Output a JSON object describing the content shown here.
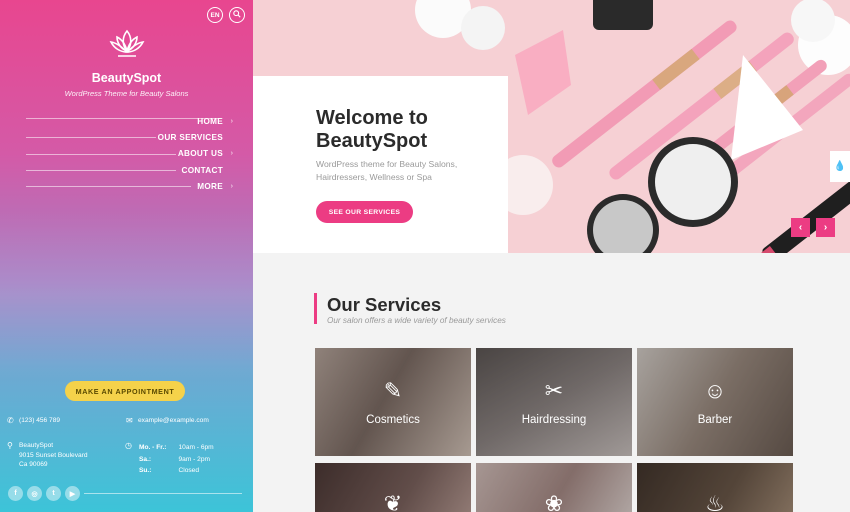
{
  "header": {
    "lang_label": "EN",
    "search_icon": "search-icon"
  },
  "brand": {
    "name": "BeautySpot",
    "tagline": "WordPress Theme for Beauty Salons",
    "logo_icon": "lotus-icon"
  },
  "nav": {
    "items": [
      {
        "label": "HOME"
      },
      {
        "label": "OUR SERVICES"
      },
      {
        "label": "ABOUT US"
      },
      {
        "label": "CONTACT"
      },
      {
        "label": "MORE"
      }
    ]
  },
  "sidebar": {
    "appointment_label": "MAKE AN APPOINTMENT",
    "phone": "(123) 456 789",
    "email": "example@example.com",
    "address": {
      "line1": "BeautySpot",
      "line2": "9015 Sunset Boulevard",
      "line3": "Ca 90069"
    },
    "hours": [
      {
        "day": "Mo. - Fr.:",
        "time": "10am - 6pm"
      },
      {
        "day": "Sa.:",
        "time": "9am - 2pm"
      },
      {
        "day": "Su.:",
        "time": "Closed"
      }
    ],
    "socials": [
      {
        "name": "facebook-icon",
        "glyph": "f"
      },
      {
        "name": "instagram-icon",
        "glyph": "◎"
      },
      {
        "name": "twitter-icon",
        "glyph": "t"
      },
      {
        "name": "youtube-icon",
        "glyph": "▶"
      }
    ]
  },
  "hero": {
    "title_line1": "Welcome to",
    "title_line2": "BeautySpot",
    "text": "WordPress theme for Beauty Salons, Hairdressers, Wellness or Spa",
    "button_label": "SEE OUR SERVICES",
    "prev_icon": "chevron-left-icon",
    "next_icon": "chevron-right-icon"
  },
  "services": {
    "title": "Our Services",
    "subtitle": "Our salon offers a wide variety of beauty services",
    "cards": [
      {
        "label": "Cosmetics",
        "icon": "✎",
        "icon_name": "makeup-brush-icon",
        "bg": "#8a7e78"
      },
      {
        "label": "Hairdressing",
        "icon": "✂",
        "icon_name": "hair-dryer-icon",
        "bg": "#6f6a6a"
      },
      {
        "label": "Barber",
        "icon": "☺",
        "icon_name": "beard-icon",
        "bg": "#9c8f86"
      },
      {
        "label": "",
        "icon": "❦",
        "icon_name": "lotion-bottle-icon",
        "bg": "#5e4b47"
      },
      {
        "label": "",
        "icon": "❀",
        "icon_name": "lotus-icon",
        "bg": "#b49a95"
      },
      {
        "label": "",
        "icon": "♨",
        "icon_name": "spa-jar-icon",
        "bg": "#5b4a3e"
      }
    ]
  },
  "colors": {
    "accent": "#ec3c83",
    "appointment": "#f5d24a"
  }
}
